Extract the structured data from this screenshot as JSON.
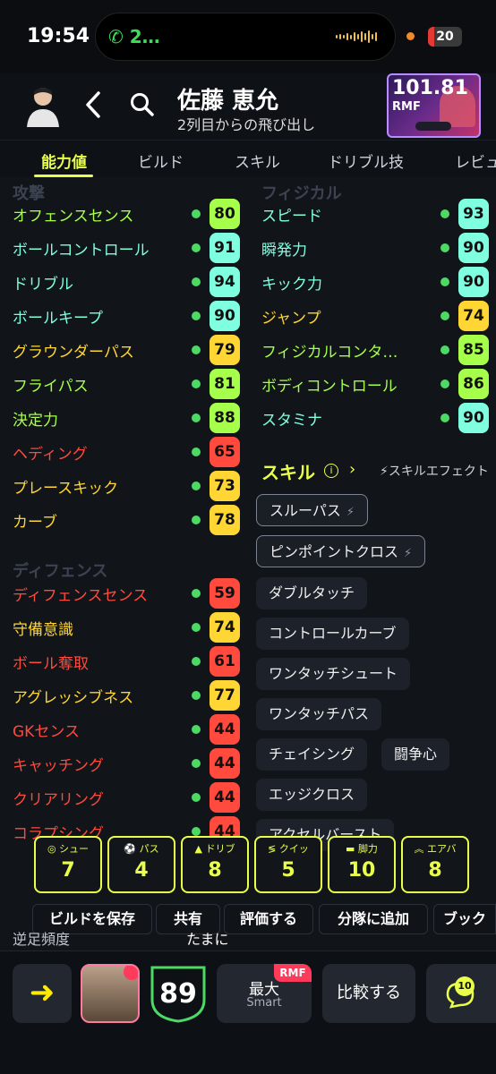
{
  "status_bar": {
    "time": "19:54",
    "call": "2…",
    "battery": "20"
  },
  "player": {
    "name": "佐藤 恵允",
    "subtitle": "2列目からの飛び出し",
    "card_rating": "101.81",
    "card_position": "RMF"
  },
  "tabs": [
    {
      "label": "能力値",
      "active": true
    },
    {
      "label": "ビルド"
    },
    {
      "label": "スキル"
    },
    {
      "label": "ドリブル技"
    },
    {
      "label": "レビュ"
    }
  ],
  "attack": {
    "title": "攻撃",
    "stats": [
      {
        "label": "オフェンスセンス",
        "value": "80",
        "color": "#a6ff4a"
      },
      {
        "label": "ボールコントロール",
        "value": "91",
        "color": "#7fffe0"
      },
      {
        "label": "ドリブル",
        "value": "94",
        "color": "#7fffe0"
      },
      {
        "label": "ボールキープ",
        "value": "90",
        "color": "#7fffe0"
      },
      {
        "label": "グラウンダーパス",
        "value": "79",
        "color": "#ffd633"
      },
      {
        "label": "フライパス",
        "value": "81",
        "color": "#a6ff4a"
      },
      {
        "label": "決定力",
        "value": "88",
        "color": "#a6ff4a"
      },
      {
        "label": "ヘディング",
        "value": "65",
        "color": "#ff4a3d"
      },
      {
        "label": "プレースキック",
        "value": "73",
        "color": "#ffd633"
      },
      {
        "label": "カーブ",
        "value": "78",
        "color": "#ffd633"
      }
    ]
  },
  "physical": {
    "title": "フィジカル",
    "stats": [
      {
        "label": "スピード",
        "value": "93",
        "color": "#7fffe0"
      },
      {
        "label": "瞬発力",
        "value": "90",
        "color": "#7fffe0"
      },
      {
        "label": "キック力",
        "value": "90",
        "color": "#7fffe0"
      },
      {
        "label": "ジャンプ",
        "value": "74",
        "color": "#ffd633"
      },
      {
        "label": "フィジカルコンタ…",
        "value": "85",
        "color": "#a6ff4a"
      },
      {
        "label": "ボディコントロール",
        "value": "86",
        "color": "#a6ff4a"
      },
      {
        "label": "スタミナ",
        "value": "90",
        "color": "#7fffe0"
      }
    ]
  },
  "defense": {
    "title": "ディフェンス",
    "stats": [
      {
        "label": "ディフェンスセンス",
        "value": "59",
        "color": "#ff4a3d"
      },
      {
        "label": "守備意識",
        "value": "74",
        "color": "#ffd633"
      },
      {
        "label": "ボール奪取",
        "value": "61",
        "color": "#ff4a3d"
      },
      {
        "label": "アグレッシブネス",
        "value": "77",
        "color": "#ffd633"
      },
      {
        "label": "GKセンス",
        "value": "44",
        "color": "#ff4a3d"
      },
      {
        "label": "キャッチング",
        "value": "44",
        "color": "#ff4a3d"
      },
      {
        "label": "クリアリング",
        "value": "44",
        "color": "#ff4a3d"
      },
      {
        "label": "コラプシング",
        "value": "44",
        "color": "#ff4a3d"
      }
    ]
  },
  "skills": {
    "title": "スキル",
    "effect_label": "スキルエフェクト",
    "items": [
      {
        "label": "スルーパス",
        "special": true
      },
      {
        "label": "ピンポイントクロス",
        "special": true
      },
      {
        "label": "ダブルタッチ"
      },
      {
        "label": "コントロールカーブ"
      },
      {
        "label": "ワンタッチシュート"
      },
      {
        "label": "ワンタッチパス"
      },
      {
        "label": "チェイシング"
      },
      {
        "label": "闘争心"
      },
      {
        "label": "エッジクロス"
      },
      {
        "label": "アクセルバースト"
      }
    ]
  },
  "summary": [
    {
      "label": "シュー",
      "icon": "crosshair-icon",
      "value": "7"
    },
    {
      "label": "パス",
      "icon": "ball-icon",
      "value": "4"
    },
    {
      "label": "ドリブ",
      "icon": "triangle-icon",
      "value": "8"
    },
    {
      "label": "クイッ",
      "icon": "speed-lines-icon",
      "value": "5"
    },
    {
      "label": "脚力",
      "icon": "train-icon",
      "value": "10"
    },
    {
      "label": "エアバ",
      "icon": "double-chevron-up-icon",
      "value": "8"
    }
  ],
  "actions": [
    "ビルドを保存",
    "共有",
    "評価する",
    "分隊に追加",
    "ブック"
  ],
  "footer": {
    "label": "逆足頻度",
    "value": "たまに"
  },
  "toolbar": {
    "rating": "89",
    "smart_top": "最大",
    "smart_bottom": "Smart",
    "position_badge": "RMF",
    "compare": "比較する",
    "chat_count": "10"
  },
  "colors": {
    "accent": "#e9ff4a",
    "background": "#111419"
  }
}
